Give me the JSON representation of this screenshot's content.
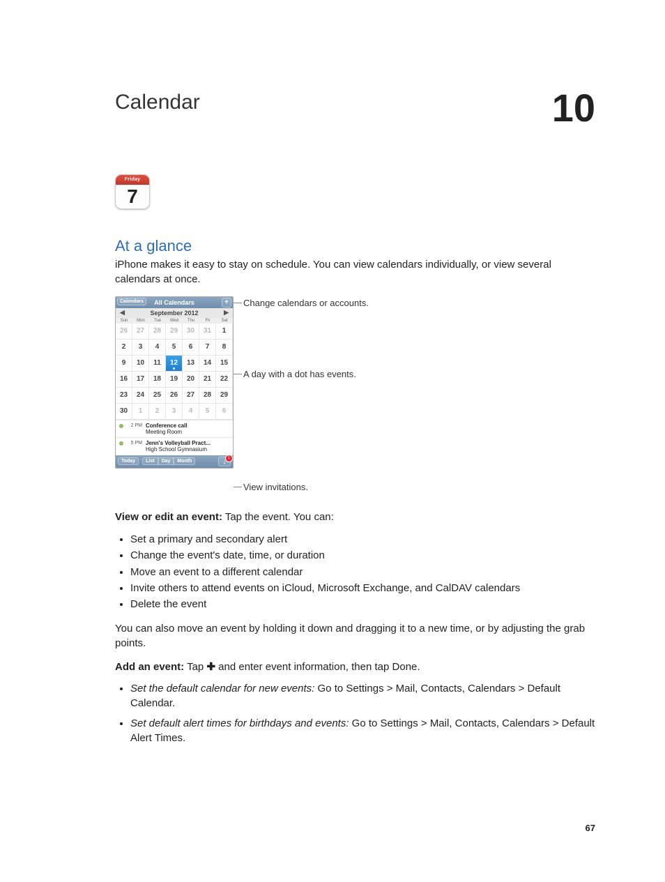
{
  "chapter": {
    "title": "Calendar",
    "number": "10"
  },
  "app_icon": {
    "weekday": "Friday",
    "day": "7"
  },
  "section_title": "At a glance",
  "intro": "iPhone makes it easy to stay on schedule. You can view calendars individually, or view several calendars at once.",
  "figure": {
    "topbar": {
      "back": "Calendars",
      "title": "All Calendars",
      "add": "+"
    },
    "month": "September 2012",
    "dow": [
      "Sun",
      "Mon",
      "Tue",
      "Wed",
      "Thu",
      "Fri",
      "Sat"
    ],
    "cells": [
      {
        "n": "26",
        "dim": true
      },
      {
        "n": "27",
        "dim": true
      },
      {
        "n": "28",
        "dim": true
      },
      {
        "n": "29",
        "dim": true
      },
      {
        "n": "30",
        "dim": true
      },
      {
        "n": "31",
        "dim": true
      },
      {
        "n": "1"
      },
      {
        "n": "2"
      },
      {
        "n": "3"
      },
      {
        "n": "4"
      },
      {
        "n": "5"
      },
      {
        "n": "6"
      },
      {
        "n": "7"
      },
      {
        "n": "8"
      },
      {
        "n": "9"
      },
      {
        "n": "10"
      },
      {
        "n": "11"
      },
      {
        "n": "12",
        "sel": true
      },
      {
        "n": "13"
      },
      {
        "n": "14"
      },
      {
        "n": "15"
      },
      {
        "n": "16"
      },
      {
        "n": "17"
      },
      {
        "n": "18"
      },
      {
        "n": "19"
      },
      {
        "n": "20"
      },
      {
        "n": "21"
      },
      {
        "n": "22"
      },
      {
        "n": "23"
      },
      {
        "n": "24"
      },
      {
        "n": "25"
      },
      {
        "n": "26"
      },
      {
        "n": "27"
      },
      {
        "n": "28"
      },
      {
        "n": "29"
      },
      {
        "n": "30"
      },
      {
        "n": "1",
        "dim": true
      },
      {
        "n": "2",
        "dim": true
      },
      {
        "n": "3",
        "dim": true
      },
      {
        "n": "4",
        "dim": true
      },
      {
        "n": "5",
        "dim": true
      },
      {
        "n": "6",
        "dim": true
      }
    ],
    "events": [
      {
        "time": "2 PM",
        "title": "Conference call",
        "loc": "Meeting Room"
      },
      {
        "time": "5 PM",
        "title": "Jenn's Volleyball Pract...",
        "loc": "High School Gymnasium"
      }
    ],
    "bottom": {
      "today": "Today",
      "list": "List",
      "day": "Day",
      "month": "Month",
      "badge": "1"
    },
    "callouts": {
      "top": "Change calendars or accounts.",
      "mid": "A day with a dot has events.",
      "bot": "View invitations."
    }
  },
  "view_edit": {
    "lead": "View or edit an event:",
    "suffix": "  Tap the event. You can:"
  },
  "view_edit_items": [
    "Set a primary and secondary alert",
    "Change the event's date, time, or duration",
    "Move an event to a different calendar",
    "Invite others to attend events on iCloud, Microsoft Exchange, and CalDAV calendars",
    "Delete the event"
  ],
  "drag_note": "You can also move an event by holding it down and dragging it to a new time, or by adjusting the grab points.",
  "add_event": {
    "lead": "Add an event:",
    "pre": "  Tap ",
    "glyph": "✚",
    "post": " and enter event information, then tap Done."
  },
  "settings_items": [
    {
      "em": "Set the default calendar for new events:",
      "rest": "  Go to Settings > Mail, Contacts, Calendars > Default Calendar."
    },
    {
      "em": "Set default alert times for birthdays and events:",
      "rest": "  Go to Settings > Mail, Contacts, Calendars > Default Alert Times."
    }
  ],
  "page_number": "67"
}
